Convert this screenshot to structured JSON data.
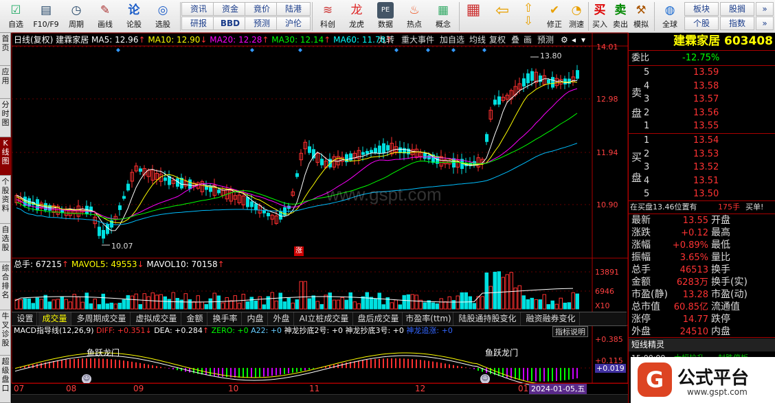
{
  "toolbar": {
    "buttons": [
      {
        "label": "自选",
        "icon": "☑"
      },
      {
        "label": "F10/F9",
        "icon": "▤"
      },
      {
        "label": "周期",
        "icon": "◷"
      },
      {
        "label": "画线",
        "icon": "✎"
      },
      {
        "label": "论股",
        "icon": "论"
      },
      {
        "label": "选股",
        "icon": "◎"
      }
    ],
    "info_buttons": [
      {
        "label": "资讯"
      },
      {
        "label": "资金"
      },
      {
        "label": "竟价"
      },
      {
        "label": "陆港"
      },
      {
        "label": "研报"
      },
      {
        "label": "BBD"
      },
      {
        "label": "预测"
      },
      {
        "label": "沪伦"
      }
    ],
    "buttons2": [
      {
        "label": "科创"
      },
      {
        "label": "龙虎"
      },
      {
        "label": "数据"
      },
      {
        "label": "热点"
      },
      {
        "label": "概念"
      }
    ],
    "buttons3": [
      {
        "label": "修正"
      },
      {
        "label": "测速"
      },
      {
        "label": "买入"
      },
      {
        "label": "卖出"
      },
      {
        "label": "模拟"
      },
      {
        "label": "全球"
      }
    ],
    "right_buttons": [
      {
        "label": "板块"
      },
      {
        "label": "股搁"
      },
      {
        "label": "个股"
      },
      {
        "label": "指数"
      }
    ]
  },
  "left_tabs": [
    "首页",
    "应用",
    "分时图",
    "K线图",
    "个股资料",
    "自选股",
    "综合排名",
    "牛叉诊股",
    "超级盘口"
  ],
  "main_header": {
    "period": "日线(复权)",
    "stock": "建霖家居",
    "ma5": "MA5: 12.96",
    "ma10": "MA10: 12.90",
    "ma20": "MA20: 12.28",
    "ma30": "MA30: 12.14",
    "ma60": "MA60: 11.78",
    "buttons": [
      "九转",
      "重大事件",
      "加自选",
      "均线",
      "复权",
      "叠",
      "画",
      "预测"
    ]
  },
  "price_axis": [
    "14.01",
    "12.98",
    "11.94",
    "10.90"
  ],
  "annotations": {
    "high": "13.80",
    "low": "10.07",
    "badge": "涨",
    "watermark": "www.gspt.com"
  },
  "volume_header": {
    "total": "总手: 67215",
    "mavol5": "MAVOL5: 49553",
    "mavol10": "MAVOL10: 70158"
  },
  "volume_axis": [
    "13891",
    "6946",
    "X10"
  ],
  "indicator_tabs": [
    "设置",
    "成交量",
    "多周期成交量",
    "虚拟成交量",
    "金额",
    "换手率",
    "内盘",
    "外盘",
    "AI立桩成交量",
    "盘后成交量",
    "市盈率(ttm)",
    "陆股通持股变化",
    "融资融券变化"
  ],
  "macd_header": {
    "name": "MACD指导线(12,26,9)",
    "diff": "DIFF: +0.351",
    "dea": "DEA: +0.284",
    "zero": "ZERO: +0",
    "a22": "A22: +0",
    "s2": "神龙抄底2号: +0",
    "s3": "神龙抄底3号: +0",
    "s4": "神龙追涨: +0",
    "help": "指标说明"
  },
  "macd_axis": [
    "+0.385",
    "+0.115",
    "+0.019"
  ],
  "macd_labels": {
    "a": "鱼跃龙门",
    "b": "鱼跃龙门"
  },
  "date_axis": [
    "07",
    "08",
    "09",
    "10",
    "11",
    "12",
    "01"
  ],
  "current_date": "2024-01-05,五",
  "quote": {
    "title": "建霖家居 603408",
    "weibi_label": "委比",
    "weibi": "-12.75%",
    "sell_label": "卖盘",
    "buy_label": "买盘",
    "asks": [
      {
        "lvl": "5",
        "price": "13.59"
      },
      {
        "lvl": "4",
        "price": "13.58"
      },
      {
        "lvl": "3",
        "price": "13.57"
      },
      {
        "lvl": "2",
        "price": "13.56"
      },
      {
        "lvl": "1",
        "price": "13.55"
      }
    ],
    "bids": [
      {
        "lvl": "1",
        "price": "13.54"
      },
      {
        "lvl": "2",
        "price": "13.53"
      },
      {
        "lvl": "3",
        "price": "13.52"
      },
      {
        "lvl": "4",
        "price": "13.51"
      },
      {
        "lvl": "5",
        "price": "13.50"
      }
    ],
    "pending": "在买盘13.46位置有",
    "pending_qty": "175手",
    "pending_side": "买单!",
    "stats": [
      {
        "l": "最新",
        "v": "13.55",
        "r": "开盘"
      },
      {
        "l": "涨跌",
        "v": "+0.12",
        "r": "最高"
      },
      {
        "l": "涨幅",
        "v": "+0.89%",
        "r": "最低"
      },
      {
        "l": "振幅",
        "v": "3.65%",
        "r": "量比"
      },
      {
        "l": "总手",
        "v": "46513",
        "r": "换手"
      },
      {
        "l": "金额",
        "v": "6283万",
        "r": "换手(实)"
      },
      {
        "l": "市盈(静)",
        "v": "13.28",
        "r": "市盈(动)"
      },
      {
        "l": "总市值",
        "v": "60.85亿",
        "r": "流通值"
      },
      {
        "l": "涨停",
        "v": "14.77",
        "r": "跌停"
      },
      {
        "l": "外盘",
        "v": "24510",
        "r": "内盘"
      }
    ],
    "elf_title": "短线精灵",
    "elf_time": "15:00:00",
    "elf_a": "大幅拉升",
    "elf_b": "封跌停板"
  },
  "brand": {
    "logo": "G",
    "name": "公式平台",
    "url": "www.gspt.com"
  }
}
